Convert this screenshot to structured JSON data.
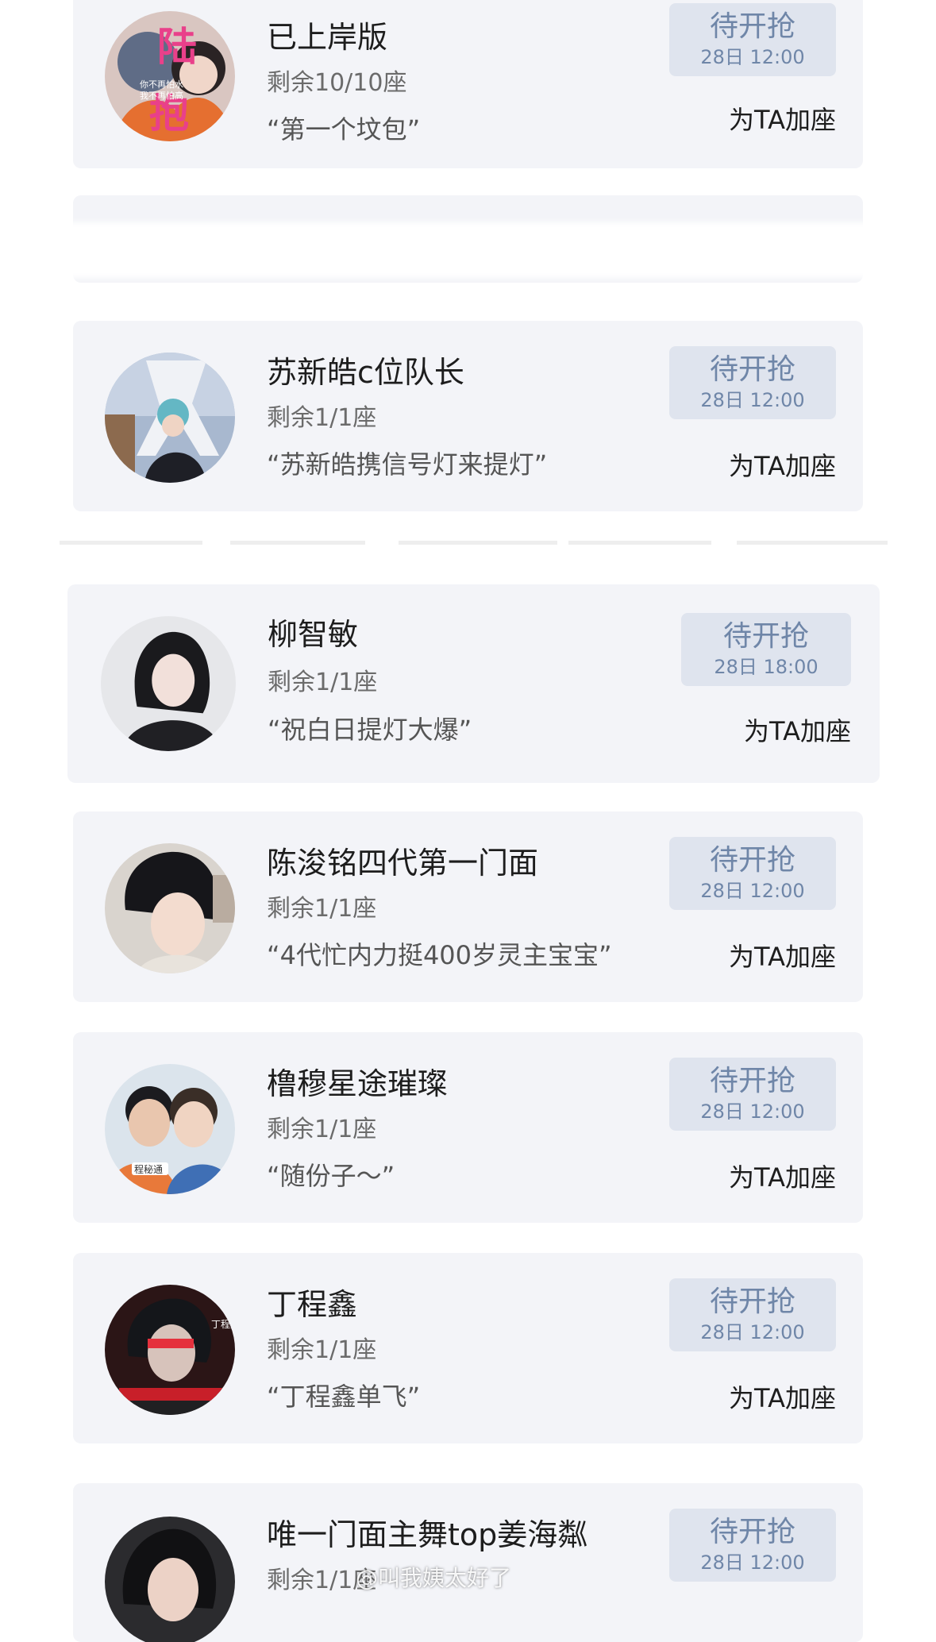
{
  "cards": [
    {
      "title": "已上岸版",
      "seats": "剩余10/10座",
      "quote": "“第一个坟包”",
      "button_label": "待开抢",
      "button_time": "28日 12:00",
      "add_seat": "为TA加座",
      "avatar_text": "陆 抱",
      "avatar_subtext_1": "你不再怕水",
      "avatar_subtext_2": "我不再怕高"
    },
    {
      "title": "苏新皓c位队长",
      "seats": "剩余1/1座",
      "quote": "“苏新皓携信号灯来提灯”",
      "button_label": "待开抢",
      "button_time": "28日 12:00",
      "add_seat": "为TA加座"
    },
    {
      "title": "柳智敏",
      "seats": "剩余1/1座",
      "quote": "“祝白日提灯大爆”",
      "button_label": "待开抢",
      "button_time": "28日 18:00",
      "add_seat": "为TA加座"
    },
    {
      "title": "陈浚铭四代第一门面",
      "seats": "剩余1/1座",
      "quote": "“4代忙内力挺400岁灵主宝宝”",
      "button_label": "待开抢",
      "button_time": "28日 12:00",
      "add_seat": "为TA加座"
    },
    {
      "title": "橹穆星途璀璨",
      "seats": "剩余1/1座",
      "quote": "“随份子～”",
      "button_label": "待开抢",
      "button_time": "28日 12:00",
      "add_seat": "为TA加座",
      "avatar_badge": "程秘通"
    },
    {
      "title": "丁程鑫",
      "seats": "剩余1/1座",
      "quote": "“丁程鑫单飞”",
      "button_label": "待开抢",
      "button_time": "28日 12:00",
      "add_seat": "为TA加座",
      "avatar_side_text": "丁程鑫"
    },
    {
      "title": "唯一门面主舞top姜海粼",
      "seats": "剩余1/1座",
      "button_label": "待开抢",
      "button_time": "28日 12:00"
    }
  ],
  "watermark": "@叫我姨太好了"
}
